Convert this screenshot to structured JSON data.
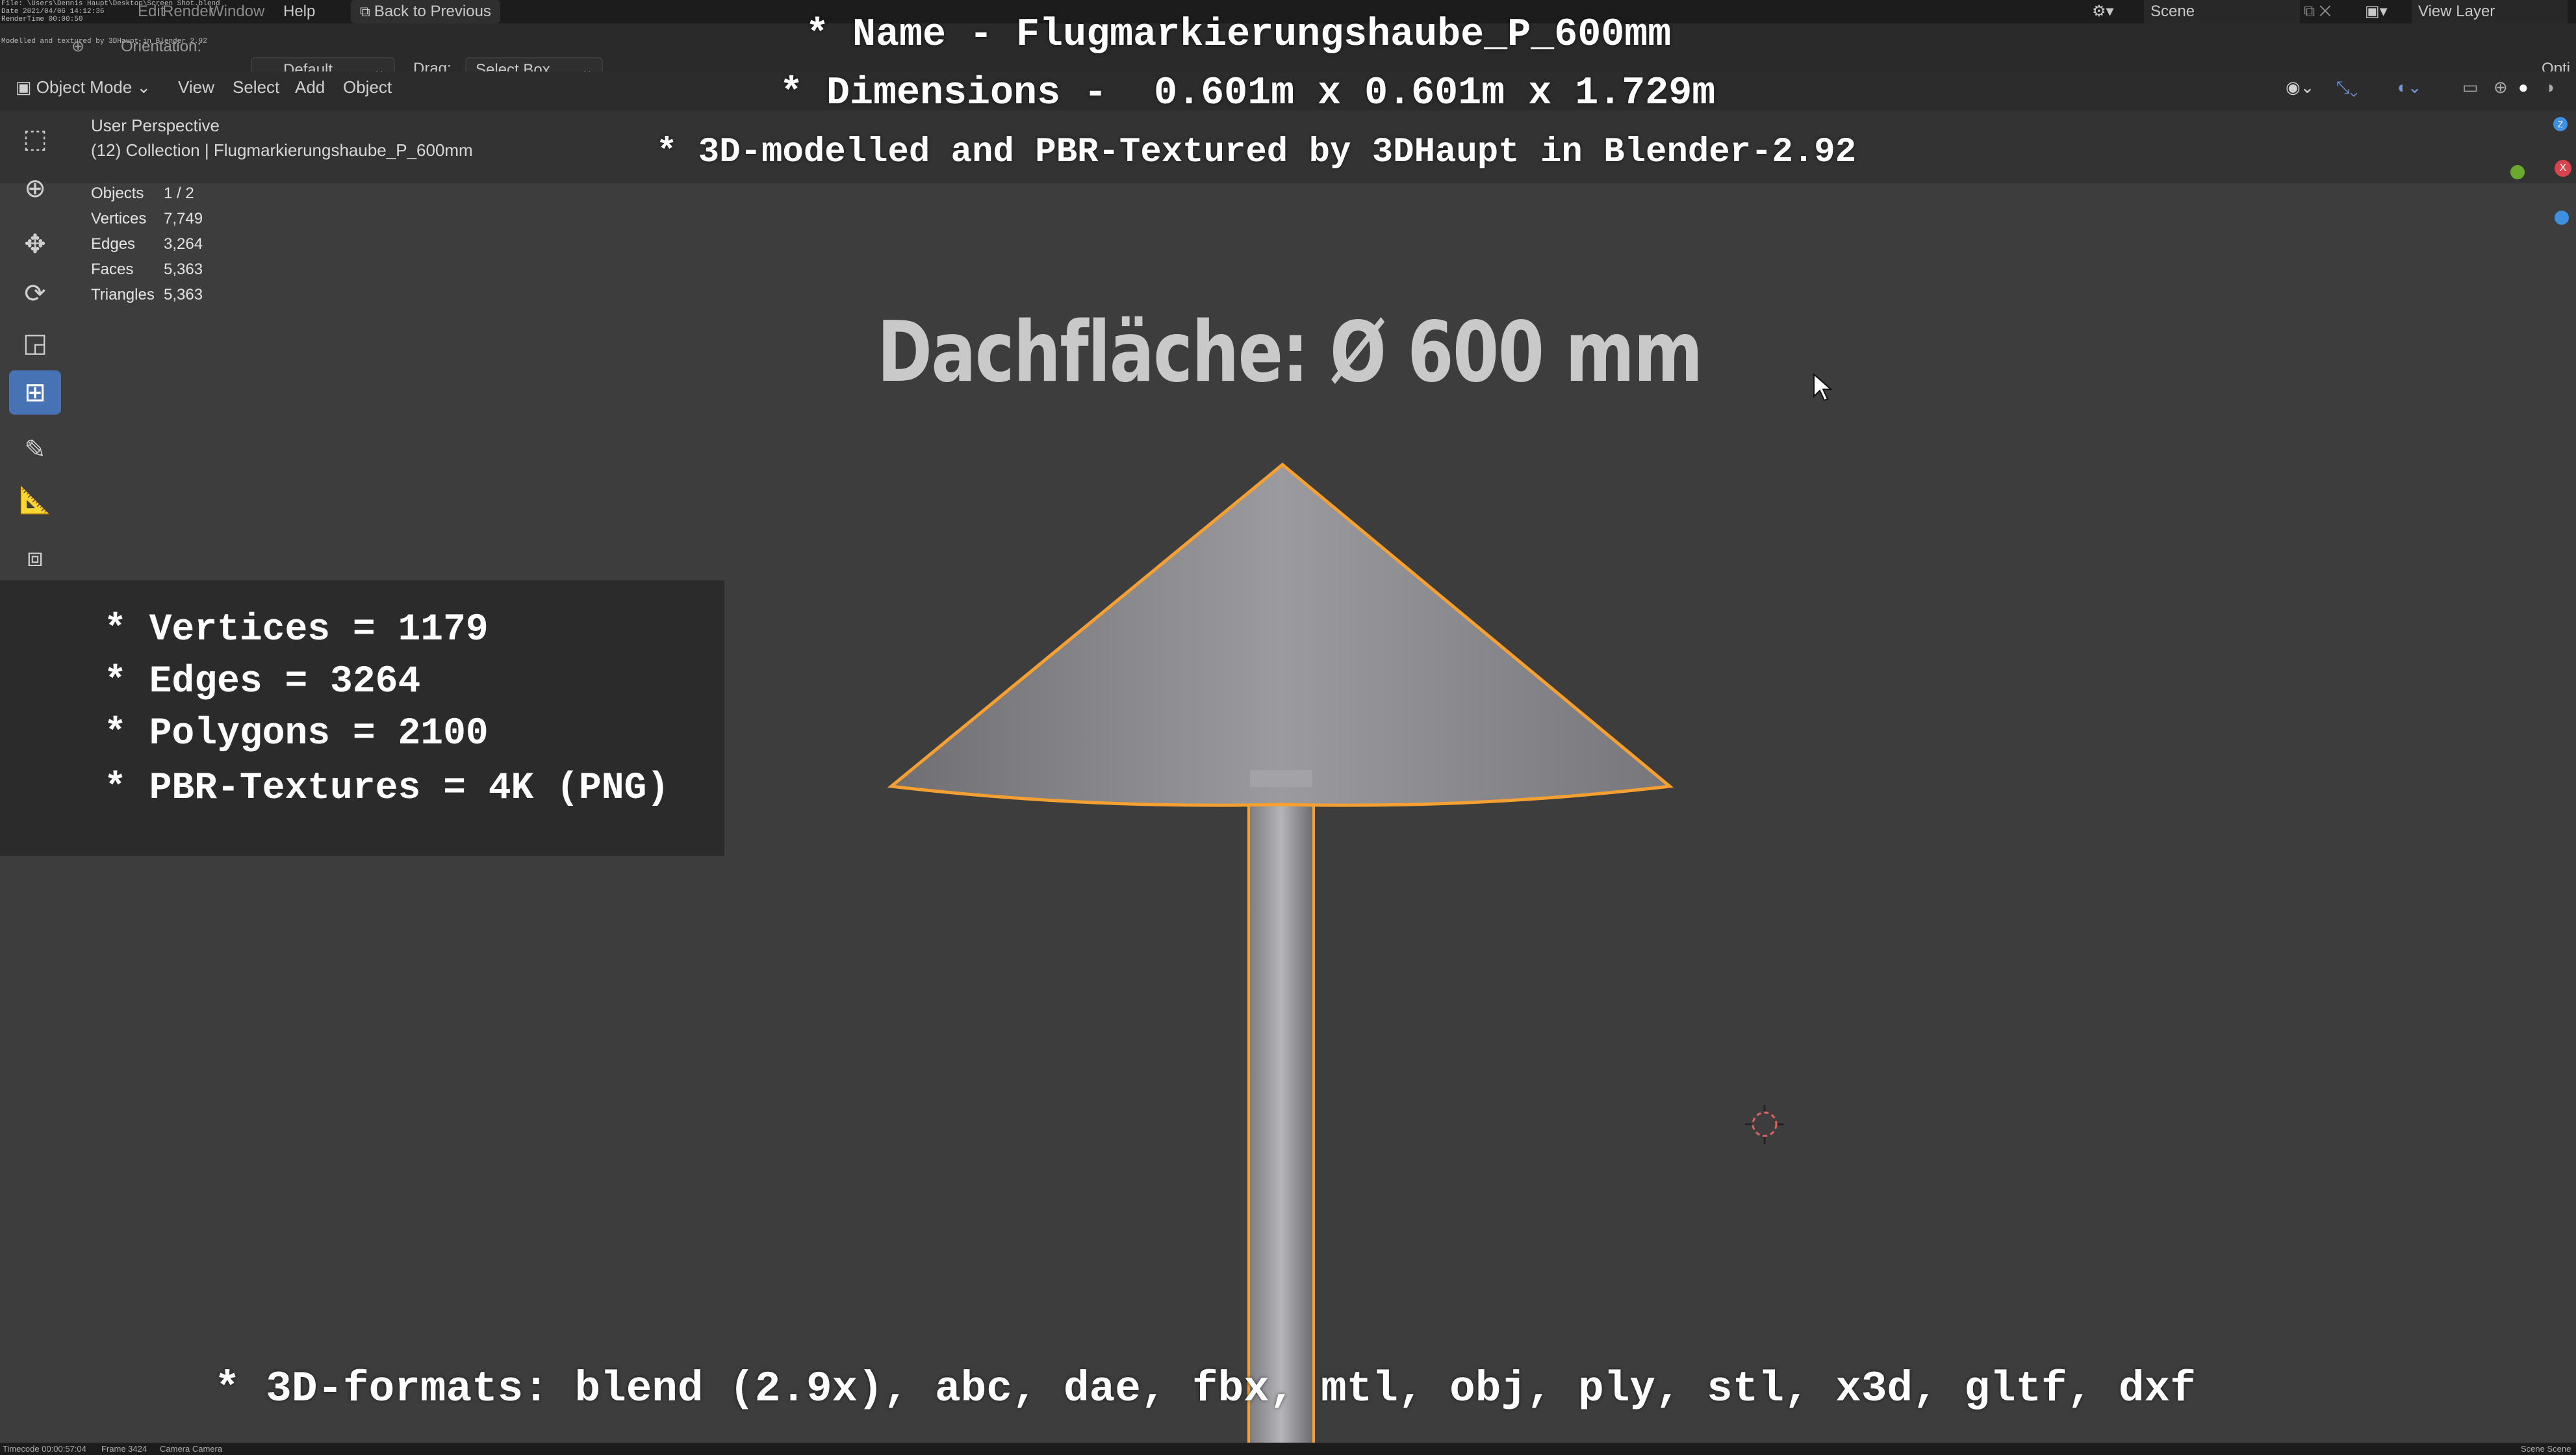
{
  "topbar": {
    "file_path": "File: \\Users\\Dennis Haupt\\Desktop\\Screen Shot.blend",
    "date": "Date 2021/04/06 14:12:36",
    "render_time": "RenderTime 00:00:50",
    "modeled_by": "Modelled and textured by 3DHaupt in Blender 2.92",
    "menu_edit": "Edit",
    "menu_render": "Render",
    "menu_window": "Window",
    "menu_help": "Help",
    "back_button": "Back to Previous",
    "scene_label": "Scene",
    "view_layer_label": "View Layer"
  },
  "header": {
    "orientation_label": "Orientation:",
    "orientation_value": "Default",
    "drag_label": "Drag:",
    "drag_value": "Select Box",
    "options_label": "Opti"
  },
  "modebar": {
    "mode": "Object Mode",
    "view": "View",
    "select": "Select",
    "add": "Add",
    "object": "Object"
  },
  "viewport": {
    "perspective": "User Perspective",
    "collection": "(12) Collection | Flugmarkierungshaube_P_600mm",
    "stats": [
      {
        "label": "Objects",
        "value": "1 / 2"
      },
      {
        "label": "Vertices",
        "value": "7,749"
      },
      {
        "label": "Edges",
        "value": "3,264"
      },
      {
        "label": "Faces",
        "value": "5,363"
      },
      {
        "label": "Triangles",
        "value": "5,363"
      }
    ],
    "dimension_label": "Dachfläche:  Ø 600 mm"
  },
  "overlay": {
    "name_line": "* Name - Flugmarkierungshaube_P_600mm",
    "dimensions_line": "* Dimensions -  0.601m x 0.601m x 1.729m",
    "credits_line": "* 3D-modelled and PBR-Textured by 3DHaupt in Blender-2.92",
    "info_lines": [
      "* Vertices = 1179",
      "* Edges = 3264",
      "* Polygons = 2100",
      "* PBR-Textures = 4K (PNG)"
    ],
    "formats_line": "* 3D-formats: blend (2.9x), abc, dae, fbx, mtl, obj, ply, stl, x3d, gltf, dxf"
  },
  "status": {
    "timecode": "Timecode 00:00:57:04",
    "frame": "Frame 3424",
    "camera": "Camera Camera",
    "scene": "Scene Scene"
  },
  "colors": {
    "selection_outline": "#f5a030",
    "active_tool": "#4772b3",
    "axis_x": "#d9434b",
    "axis_y": "#6aa82e",
    "axis_z": "#3d8fe0"
  }
}
